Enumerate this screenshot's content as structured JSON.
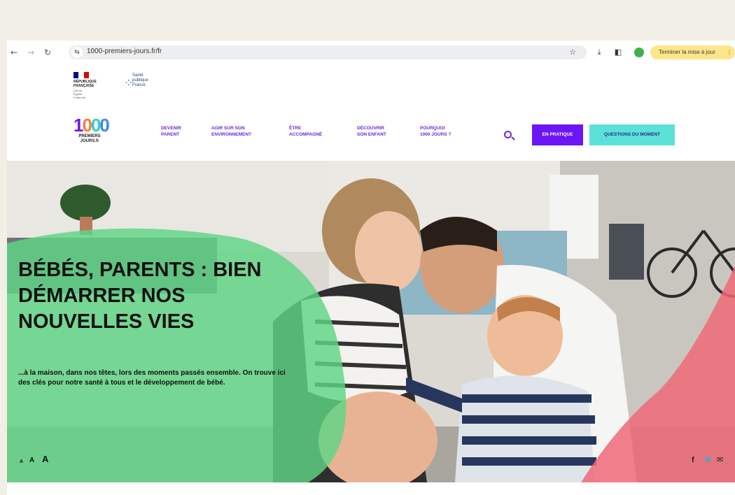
{
  "browser": {
    "back_icon": "arrow-left",
    "forward_icon": "arrow-right",
    "reload_icon": "reload",
    "url": "1000-premiers-jours.fr/fr",
    "update_label": "Terminer la mise à jour",
    "icons": [
      "star-icon",
      "download-icon",
      "side-panel-icon",
      "profile-icon",
      "menu-icon"
    ]
  },
  "header": {
    "gov_logo": {
      "name": "République Française",
      "lines": [
        "RÉPUBLIQUE",
        "FRANÇAISE"
      ],
      "motto": [
        "Liberté",
        "Égalité",
        "Fraternité"
      ]
    },
    "sp_logo": {
      "lines": [
        "Santé",
        "publique",
        "France"
      ]
    },
    "brand": {
      "number": "1000",
      "lines": [
        "PREMIERS",
        "JOURS.fr"
      ]
    },
    "nav": [
      {
        "line1": "DEVENIR",
        "line2": "PARENT"
      },
      {
        "line1": "AGIR SUR SON",
        "line2": "ENVIRONNEMENT"
      },
      {
        "line1": "ÊTRE",
        "line2": "ACCOMPAGNÉ"
      },
      {
        "line1": "DÉCOUVRIR",
        "line2": "SON ENFANT"
      },
      {
        "line1": "POURQUOI",
        "line2": "1000 JOURS ?"
      }
    ],
    "btn_pratique": "EN PRATIQUE",
    "btn_questions": "QUESTIONS DU MOMENT"
  },
  "hero": {
    "title": "BÉBÉS, PARENTS : BIEN DÉMARRER NOS NOUVELLES VIES",
    "text": "...à la maison, dans nos têtes, lors des moments passés ensemble. On trouve ici des clés pour notre santé à tous et le développement de bébé.",
    "font_sizes": [
      "A",
      "A",
      "A"
    ],
    "share": [
      "f",
      "🐦",
      "✉"
    ]
  },
  "colors": {
    "purple": "#6c16f6",
    "teal": "#5ce1d8",
    "green_overlay": "#5fd685",
    "pink_overlay": "#ef6a78"
  }
}
